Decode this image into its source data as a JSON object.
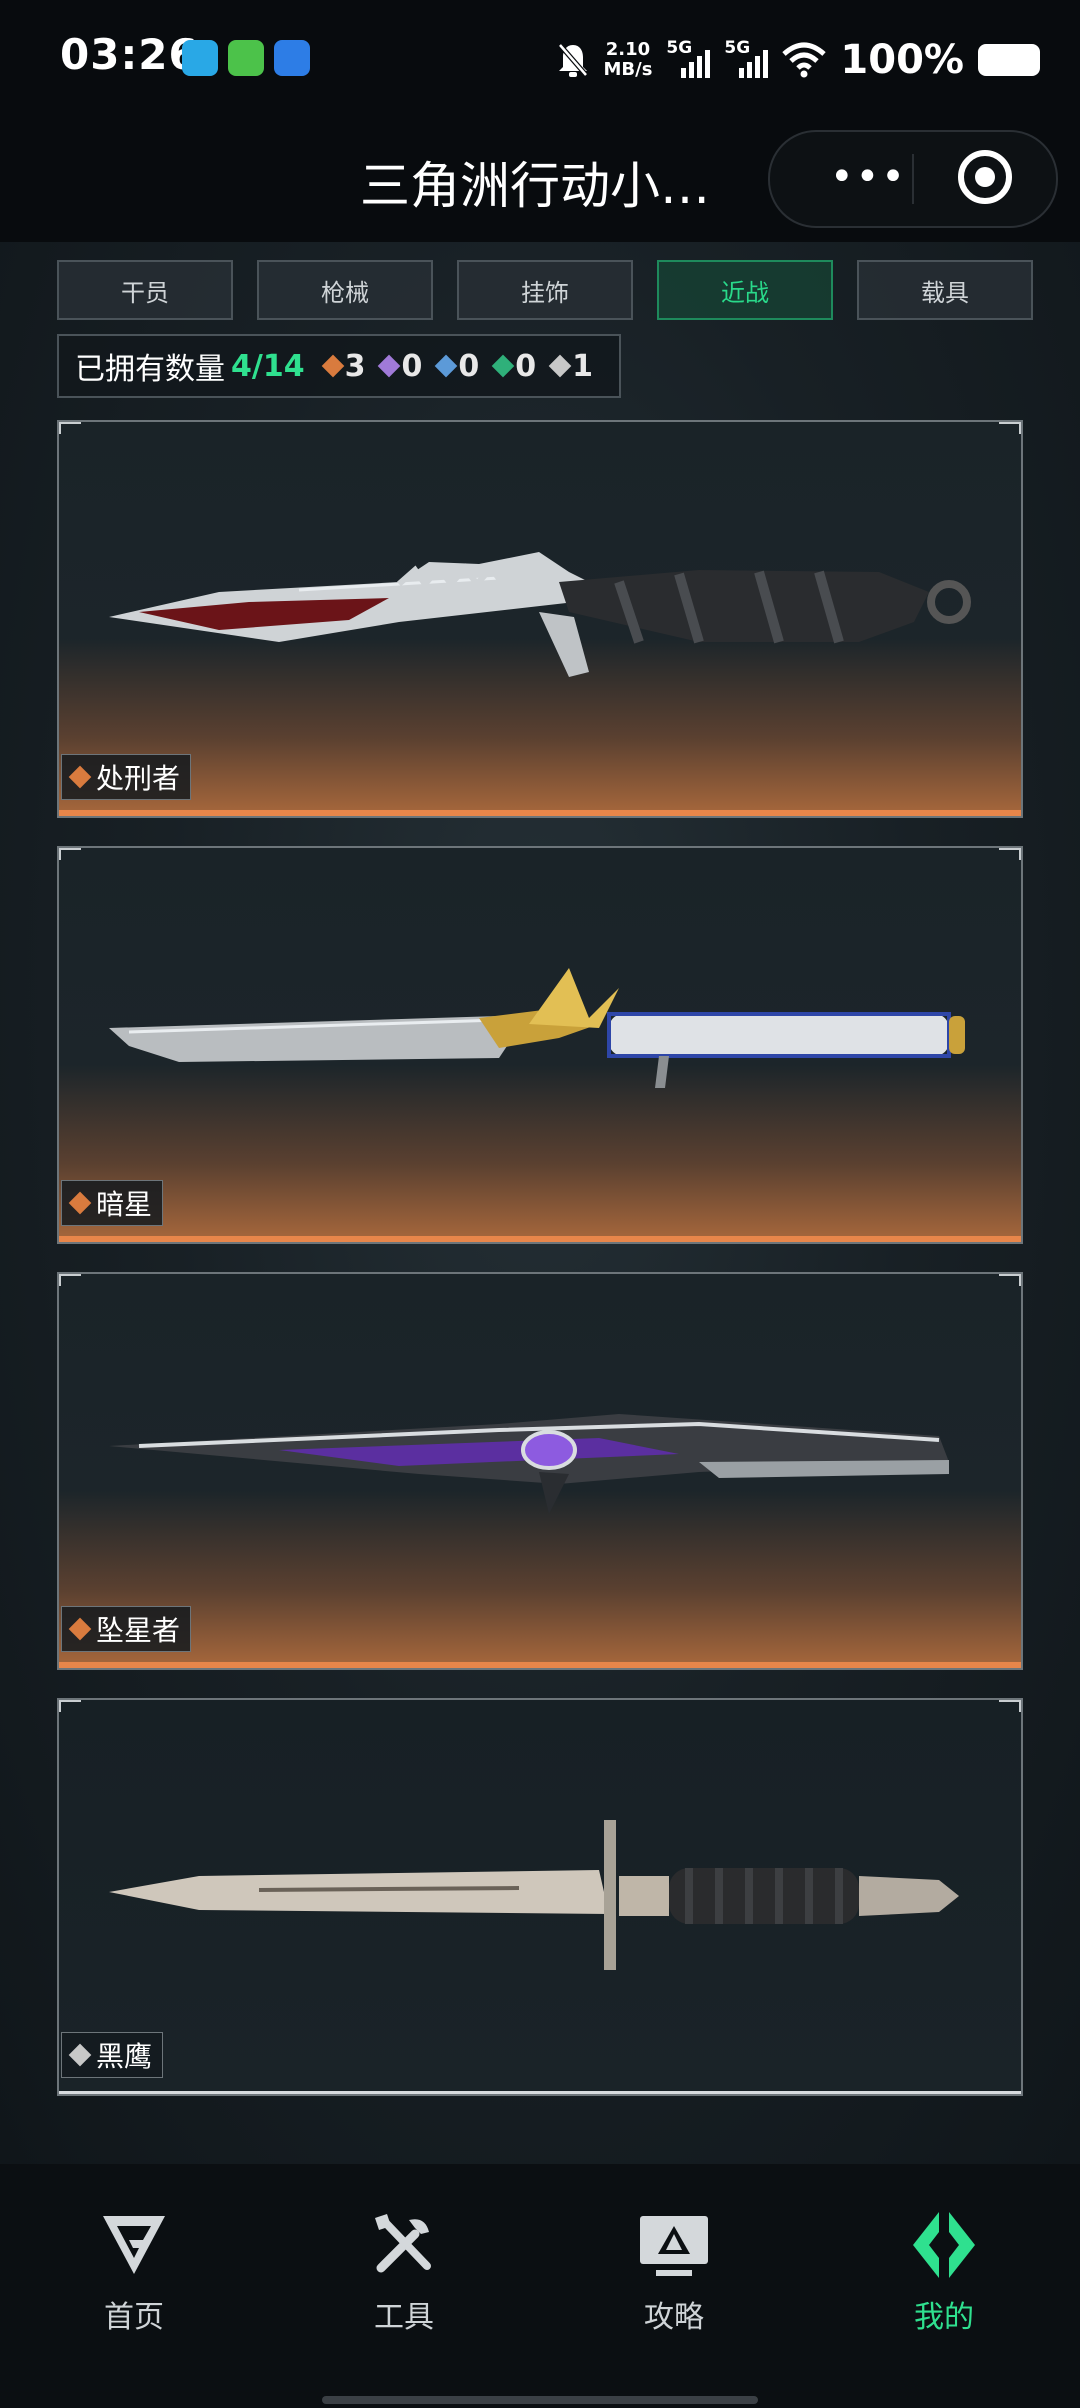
{
  "status_bar": {
    "time": "03:26",
    "net_speed_value": "2.10",
    "net_speed_unit": "MB/s",
    "sim1": "5G",
    "sim2": "5G",
    "battery": "100%"
  },
  "nav": {
    "title": "三角洲行动小…",
    "more_label": "•••"
  },
  "tabs": [
    {
      "label": "干员",
      "active": false
    },
    {
      "label": "枪械",
      "active": false
    },
    {
      "label": "挂饰",
      "active": false
    },
    {
      "label": "近战",
      "active": true
    },
    {
      "label": "载具",
      "active": false
    }
  ],
  "stats": {
    "label": "已拥有数量",
    "owned": "4/14",
    "rarities": [
      {
        "color": "#d97b3e",
        "count": "3"
      },
      {
        "color": "#a07ad8",
        "count": "0"
      },
      {
        "color": "#5c9ad8",
        "count": "0"
      },
      {
        "color": "#2fb07a",
        "count": "0"
      },
      {
        "color": "#c8c8c8",
        "count": "1"
      }
    ]
  },
  "cards": [
    {
      "name": "处刑者",
      "rarity_color": "#d97b3e",
      "weapon": "executioner-knife"
    },
    {
      "name": "暗星",
      "rarity_color": "#d97b3e",
      "weapon": "dark-star-knife"
    },
    {
      "name": "坠星者",
      "rarity_color": "#d97b3e",
      "weapon": "star-faller-knife"
    },
    {
      "name": "黑鹰",
      "rarity_color": "#c8c8c8",
      "weapon": "black-hawk-knife"
    }
  ],
  "bottom_nav": [
    {
      "label": "首页",
      "icon": "home-logo-icon",
      "active": false
    },
    {
      "label": "工具",
      "icon": "tools-icon",
      "active": false
    },
    {
      "label": "攻略",
      "icon": "guide-monitor-icon",
      "active": false
    },
    {
      "label": "我的",
      "icon": "profile-logo-icon",
      "active": true
    }
  ]
}
